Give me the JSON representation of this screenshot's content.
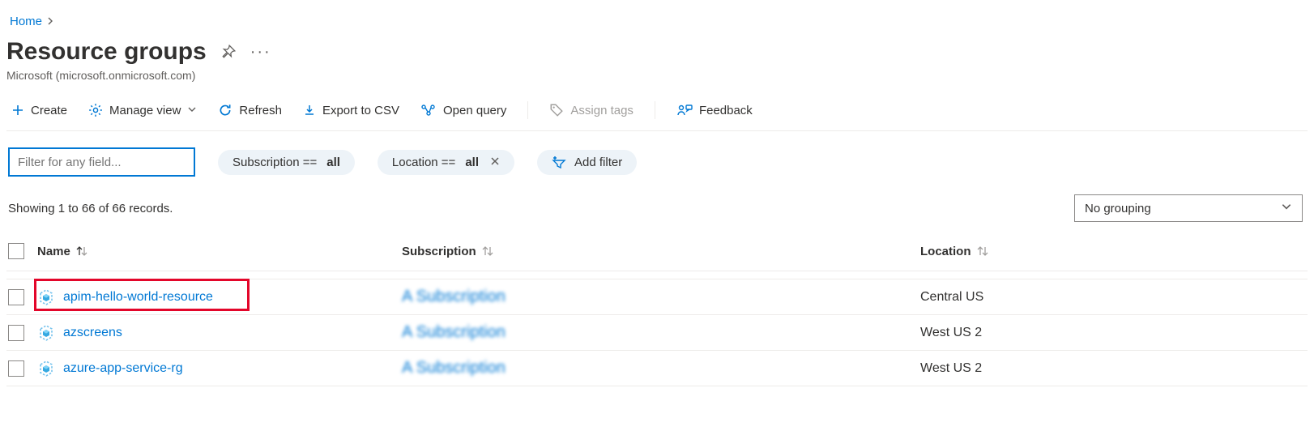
{
  "breadcrumb": {
    "home": "Home"
  },
  "header": {
    "title": "Resource groups",
    "subtitle": "Microsoft (microsoft.onmicrosoft.com)"
  },
  "toolbar": {
    "create": "Create",
    "manage_view": "Manage view",
    "refresh": "Refresh",
    "export_csv": "Export to CSV",
    "open_query": "Open query",
    "assign_tags": "Assign tags",
    "feedback": "Feedback"
  },
  "filters": {
    "placeholder": "Filter for any field...",
    "subscription_label": "Subscription ==",
    "subscription_value": "all",
    "location_label": "Location ==",
    "location_value": "all",
    "add_filter": "Add filter"
  },
  "status": {
    "showing": "Showing 1 to 66 of 66 records.",
    "grouping": "No grouping"
  },
  "columns": {
    "name": "Name",
    "subscription": "Subscription",
    "location": "Location"
  },
  "rows": [
    {
      "name": "apim-hello-world-resource",
      "subscription": "A Subscription",
      "location": "Central US",
      "highlighted": true
    },
    {
      "name": "azscreens",
      "subscription": "A Subscription",
      "location": "West US 2"
    },
    {
      "name": "azure-app-service-rg",
      "subscription": "A Subscription",
      "location": "West US 2"
    }
  ]
}
